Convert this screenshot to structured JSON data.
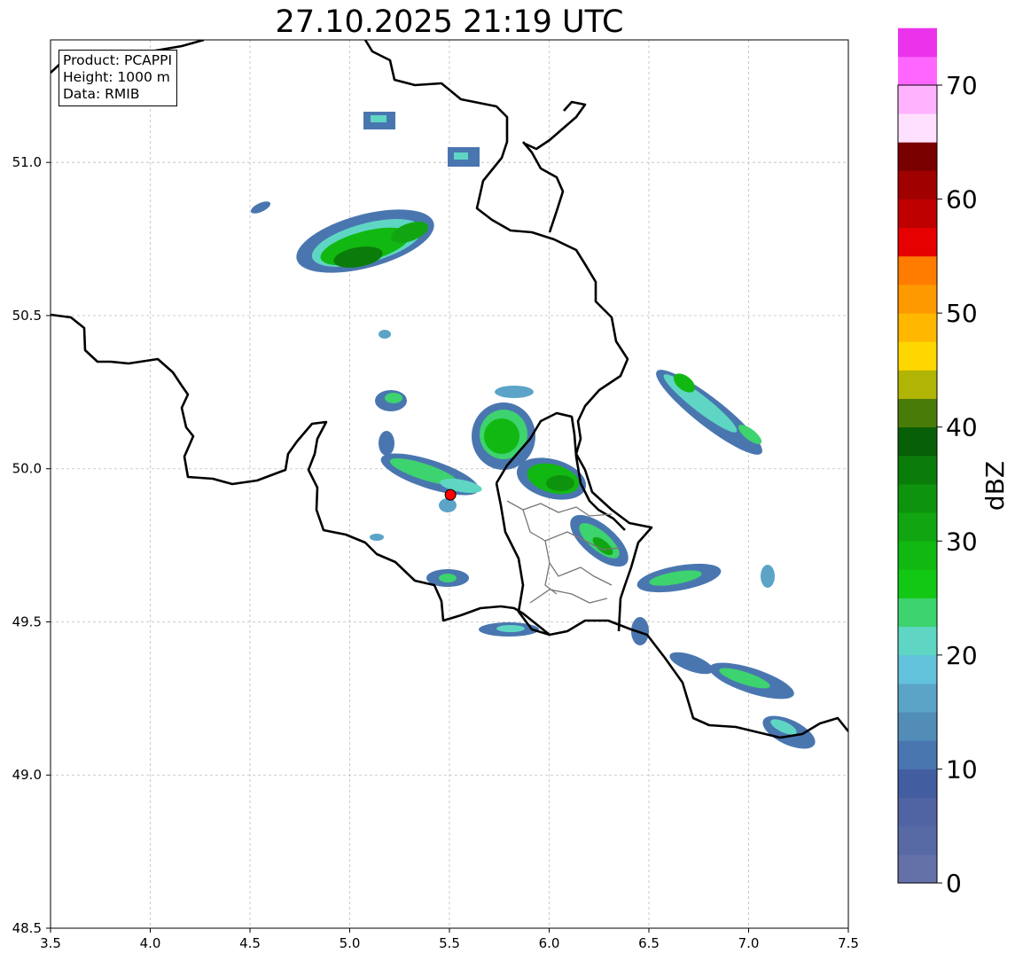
{
  "title": "27.10.2025 21:19 UTC",
  "info": {
    "product": "Product: PCAPPI",
    "height": "Height: 1000 m",
    "data": "Data: RMIB"
  },
  "map": {
    "xlim": [
      3.5,
      7.5
    ],
    "ylim": [
      48.5,
      51.4
    ],
    "x_ticks": [
      "3.5",
      "4.0",
      "4.5",
      "5.0",
      "5.5",
      "6.0",
      "6.5",
      "7.0",
      "7.5"
    ],
    "y_ticks": [
      "48.5",
      "49.0",
      "49.5",
      "50.0",
      "50.5",
      "51.0"
    ],
    "grid": true,
    "radar_site": {
      "lon": 5.505,
      "lat": 49.915,
      "color": "#ff0000"
    }
  },
  "colorbar": {
    "label": "dBZ",
    "min": 0,
    "max": 70,
    "tick_labels": [
      "0",
      "10",
      "20",
      "30",
      "40",
      "50",
      "60",
      "70"
    ],
    "step": 2.5,
    "colors": [
      "#6470a8",
      "#576aa6",
      "#5063a3",
      "#425da0",
      "#4a76b0",
      "#528db8",
      "#5ba4c8",
      "#62c2db",
      "#5fd6c4",
      "#3dd36e",
      "#12c814",
      "#12b812",
      "#11a611",
      "#0e930e",
      "#0a7c0a",
      "#075f07",
      "#497b08",
      "#b0b405",
      "#ffd700",
      "#ffb700",
      "#ff9900",
      "#ff7c00",
      "#e60000",
      "#bf0000",
      "#a00000",
      "#7a0000",
      "#ffe1ff",
      "#ffb3ff",
      "#ff66ff",
      "#ec33ec"
    ]
  }
}
